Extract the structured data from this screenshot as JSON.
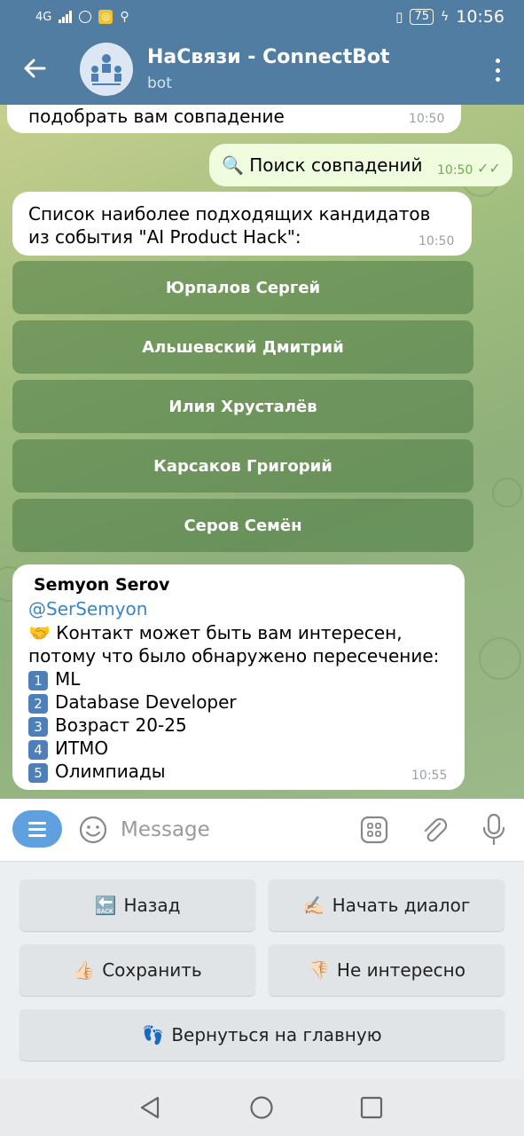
{
  "status_bar": {
    "network": "4G",
    "battery": "75",
    "time": "10:56"
  },
  "header": {
    "title": "НаСвязи - ConnectBot",
    "subtitle": "bot"
  },
  "messages": {
    "partial": {
      "text": "подобрать вам совпадение",
      "time": "10:50"
    },
    "outgoing": {
      "text": "🔍 Поиск совпадений",
      "time": "10:50"
    },
    "candidates_intro": {
      "text": "Список наиболее подходящих кандидатов из события \"AI Product Hack\":",
      "time": "10:50"
    },
    "candidate_buttons": [
      "Юрпалов Сергей",
      "Альшевский Дмитрий",
      "Илия Хрусталёв",
      "Карсаков Григорий",
      "Серов Семён"
    ],
    "profile": {
      "name": "Semyon Serov",
      "username": "@SerSemyon",
      "intro": "🤝 Контакт может быть вам интересен, потому что было обнаружено пересечение:",
      "items": [
        {
          "num": "1",
          "text": "ML"
        },
        {
          "num": "2",
          "text": "Database Developer"
        },
        {
          "num": "3",
          "text": "Возраст 20-25"
        },
        {
          "num": "4",
          "text": "ИТМО"
        },
        {
          "num": "5",
          "text": "Олимпиады"
        }
      ],
      "time": "10:55"
    }
  },
  "input": {
    "placeholder": "Message"
  },
  "keyboard": {
    "back": {
      "icon": "🔙",
      "label": "Назад"
    },
    "start_dialog": {
      "icon": "✍🏻",
      "label": "Начать диалог"
    },
    "save": {
      "icon": "👍🏻",
      "label": "Сохранить"
    },
    "not_interesting": {
      "icon": "👎🏻",
      "label": "Не интересно"
    },
    "home": {
      "icon": "👣",
      "label": "Вернуться на главную"
    }
  }
}
